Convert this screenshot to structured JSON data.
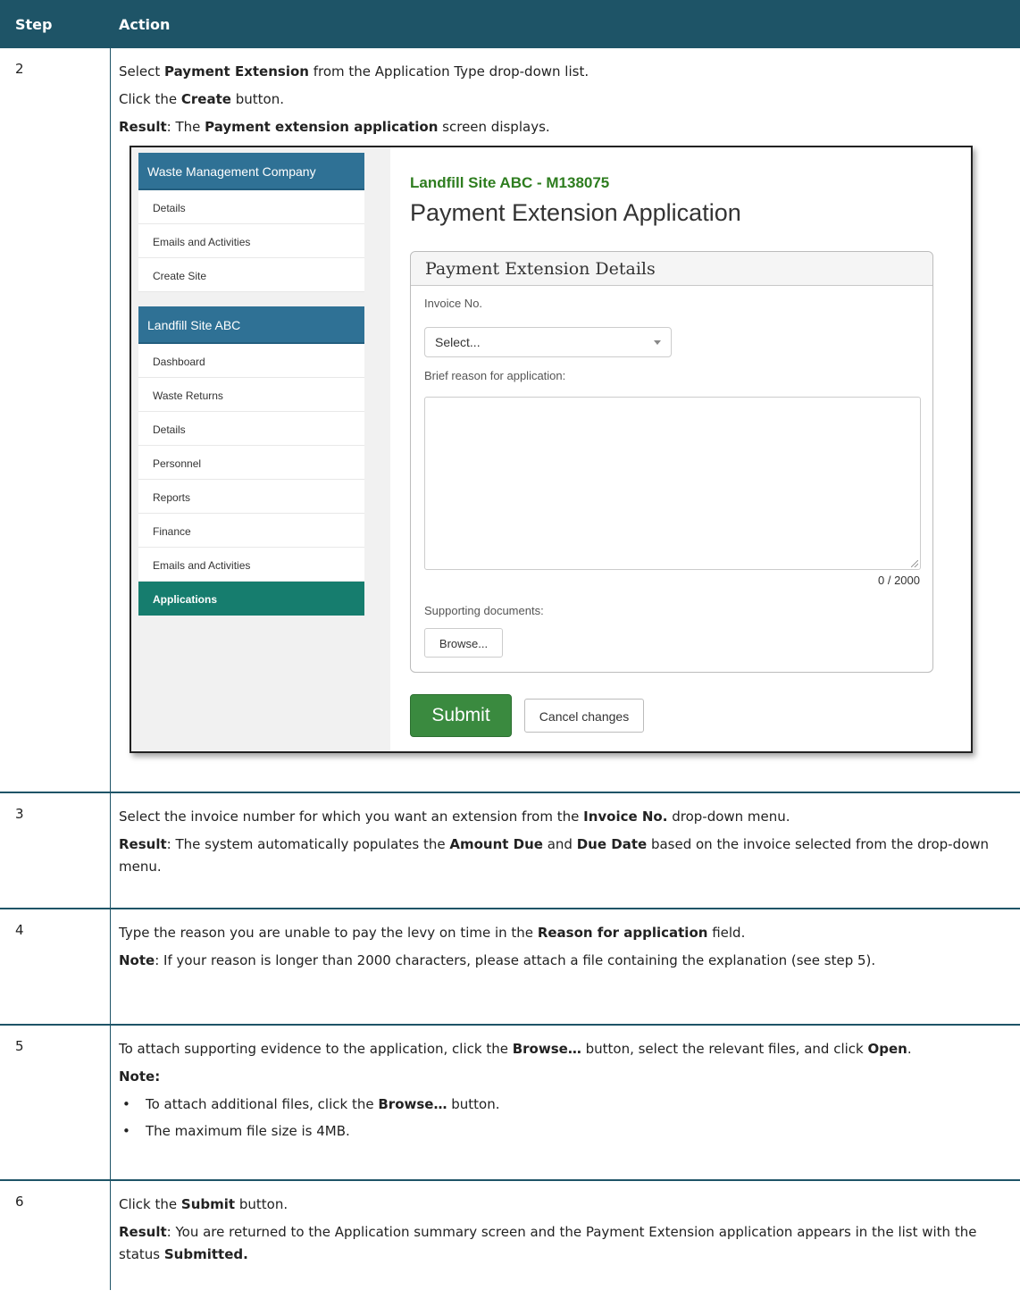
{
  "table": {
    "header": {
      "step": "Step",
      "action": "Action"
    }
  },
  "steps": {
    "s2": {
      "num": "2",
      "line1": {
        "a": "Select ",
        "b": "Payment Extension",
        "c": " from the Application Type drop-down list."
      },
      "line2": {
        "a": "Click the ",
        "b": "Create",
        "c": " button."
      },
      "line3": {
        "a": "Result",
        "b": ": The ",
        "c": "Payment extension application",
        "d": " screen displays."
      }
    },
    "s3": {
      "num": "3",
      "line1": {
        "a": "Select the invoice number for which you want an extension from the ",
        "b": "Invoice No.",
        "c": " drop-down menu."
      },
      "line2": {
        "a": "Result",
        "b": ": The system automatically populates the ",
        "c": "Amount Due",
        "d": " and ",
        "e": "Due Date",
        "f": " based on the invoice selected from the drop-down menu."
      }
    },
    "s4": {
      "num": "4",
      "line1": {
        "a": "Type the reason you are unable to pay the levy on time in the ",
        "b": "Reason for application",
        "c": " field."
      },
      "line2": {
        "a": "Note",
        "b": ": If your reason is longer than 2000 characters, please attach a file containing the explanation (see step 5)."
      }
    },
    "s5": {
      "num": "5",
      "line1": {
        "a": "To attach supporting evidence to the application, click the ",
        "b": "Browse…",
        "c": " button, select the relevant files, and click ",
        "d": "Open",
        "e": "."
      },
      "note": "Note:",
      "bullet1": {
        "a": "To attach additional files, click the ",
        "b": "Browse…",
        "c": " button."
      },
      "bullet2": "The maximum file size is 4MB."
    },
    "s6": {
      "num": "6",
      "line1": {
        "a": "Click the ",
        "b": "Submit",
        "c": " button."
      },
      "line2": {
        "a": "Result",
        "b": ": You are returned to the Application summary screen and the Payment Extension application appears in the list with the status ",
        "c": "Submitted."
      }
    }
  },
  "screenshot": {
    "sidebar": {
      "company_header": "Waste Management Company",
      "company_items": [
        "Details",
        "Emails and Activities",
        "Create Site"
      ],
      "site_header": "Landfill Site ABC",
      "site_items": [
        "Dashboard",
        "Waste Returns",
        "Details",
        "Personnel",
        "Reports",
        "Finance",
        "Emails and Activities",
        "Applications"
      ],
      "active_item": "Applications"
    },
    "site_title": "Landfill Site ABC - M138075",
    "page_title": "Payment Extension Application",
    "panel_title": "Payment Extension Details",
    "invoice_label": "Invoice No.",
    "invoice_select": "Select...",
    "reason_label": "Brief reason for application:",
    "reason_value": "",
    "char_count": "0 / 2000",
    "docs_label": "Supporting documents:",
    "browse_label": "Browse...",
    "submit_label": "Submit",
    "cancel_label": "Cancel changes",
    "colors": {
      "site_title": "#2e7d1f",
      "sidebar_header": "#2f7195",
      "active_item": "#167d6e",
      "submit": "#3a8a3f",
      "table_header": "#1e5467"
    }
  }
}
